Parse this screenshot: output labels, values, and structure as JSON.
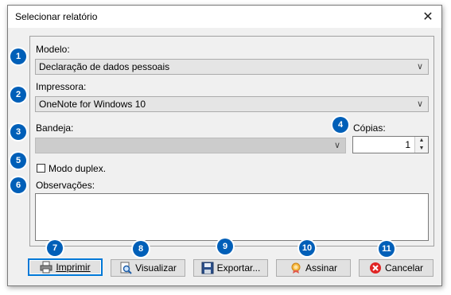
{
  "window": {
    "title": "Selecionar relatório"
  },
  "modelo": {
    "label": "Modelo:",
    "value": "Declaração de dados pessoais"
  },
  "impressora": {
    "label": "Impressora:",
    "value": "OneNote for Windows 10"
  },
  "bandeja": {
    "label": "Bandeja:",
    "value": ""
  },
  "copias": {
    "label": "Cópias:",
    "value": "1"
  },
  "duplex": {
    "label": "Modo duplex.",
    "checked": false
  },
  "observacoes": {
    "label": "Observações:",
    "value": ""
  },
  "buttons": {
    "imprimir": "Imprimir",
    "visualizar": "Visualizar",
    "exportar": "Exportar...",
    "assinar": "Assinar",
    "cancelar": "Cancelar"
  },
  "badges": [
    "1",
    "2",
    "3",
    "4",
    "5",
    "6",
    "7",
    "8",
    "9",
    "10",
    "11"
  ],
  "colors": {
    "badge": "#005fb8",
    "default_button_border": "#0078d7",
    "cancel_icon": "#e02424"
  }
}
